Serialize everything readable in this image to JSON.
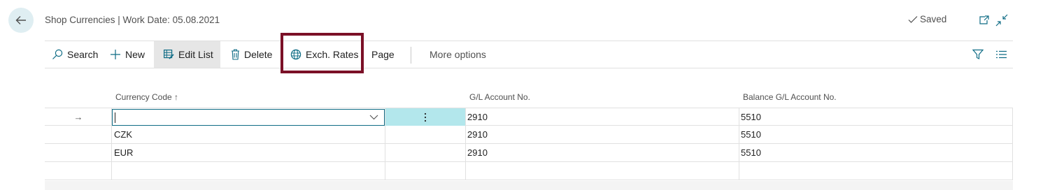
{
  "header": {
    "back_icon": "arrow-left-icon",
    "title": "Shop Currencies | Work Date: 05.08.2021",
    "saved_label": "Saved",
    "saved_icon": "checkmark-icon",
    "open_new_window_icon": "open-in-new-window-icon",
    "collapse_icon": "collapse-icon"
  },
  "toolbar": {
    "search_label": "Search",
    "new_label": "New",
    "edit_list_label": "Edit List",
    "delete_label": "Delete",
    "exch_rates_label": "Exch. Rates",
    "page_label": "Page",
    "more_options_label": "More options",
    "filter_icon": "filter-icon",
    "list_view_icon": "list-view-icon"
  },
  "grid": {
    "columns": [
      "Currency Code ↑",
      "G/L Account No.",
      "Balance G/L Account No."
    ],
    "rows": [
      {
        "indicator": "→",
        "code": "",
        "gl": "2910",
        "balance": "5510"
      },
      {
        "indicator": "",
        "code": "CZK",
        "gl": "2910",
        "balance": "5510"
      },
      {
        "indicator": "",
        "code": "EUR",
        "gl": "2910",
        "balance": "5510"
      },
      {
        "indicator": "",
        "code": "",
        "gl": "",
        "balance": ""
      }
    ]
  },
  "colors": {
    "accent": "#0f6c85",
    "highlight_border": "#7b1027",
    "back_button_bg": "#dfeef2",
    "selected_cell_bg": "#b3e7ec"
  }
}
